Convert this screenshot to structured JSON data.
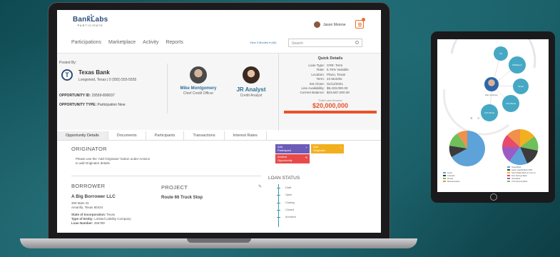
{
  "app": {
    "logo_name": "BankLabs",
    "logo_sub": "PARTICIPATE",
    "user_name": "Jason Monroe"
  },
  "nav": [
    "Participations",
    "Marketplace",
    "Activity",
    "Reports"
  ],
  "filter_text": "View 3 Months ▾  (All)",
  "search": {
    "placeholder": "Search"
  },
  "header": {
    "posted_by": "Posted By:",
    "bank": "Texas Bank",
    "bank_address": "Longwood, Texas | 0 (555) 555-5555",
    "opp_id_label": "OPPORTUNITY ID:",
    "opp_id": "15559-800037",
    "opp_type_label": "OPPORTUNITY TYPE:",
    "opp_type": "Participation New"
  },
  "people": [
    {
      "name": "Mike Montgomery",
      "title": "Chief Credit Officer"
    },
    {
      "name": "JR Analyst",
      "title": "Credit Analyst"
    }
  ],
  "quick_details": {
    "title": "Quick Details",
    "rows": [
      {
        "k": "Loan Type:",
        "v": "CRE: Term"
      },
      {
        "k": "Rate:",
        "v": "5.75% Variable"
      },
      {
        "k": "Location:",
        "v": "Plano, Texas"
      },
      {
        "k": "Term:",
        "v": "24 Months"
      },
      {
        "k": "Est Close:",
        "v": "01/12/2021"
      },
      {
        "k": "Line Availability:",
        "v": "$9,433,000.00"
      },
      {
        "k": "Current Balance:",
        "v": "$19,567,000.00"
      }
    ],
    "total_label": "Total Loan Amount",
    "total": "$20,000,000"
  },
  "tabs": [
    "Opportunity Details",
    "Documents",
    "Participants",
    "Transactions",
    "Interest Rates"
  ],
  "originator": {
    "title": "ORIGINATOR",
    "note_l1": "Please use the 'Add Originator' button under Actions",
    "note_l2": "to add Originator details."
  },
  "actions": [
    {
      "label_l1": "Add",
      "label_l2": "Participant",
      "color": "#6d5bb8"
    },
    {
      "label_l1": "Add",
      "label_l2": "Originator",
      "color": "#f2b01e"
    },
    {
      "label_l1": "Archive",
      "label_l2": "Opportunity",
      "color": "#e84a4a"
    }
  ],
  "borrower": {
    "title": "BORROWER",
    "name": "A Big Borrower LLC",
    "addr1": "300 Main St.",
    "addr2": "Amarillo, Texas 80434",
    "state_label": "State of Incorporation:",
    "state": "Texas",
    "entity_label": "Type of Entity:",
    "entity": "Limited Liability Company",
    "loan_label": "Loan Number:",
    "loan": "456789"
  },
  "project": {
    "title": "PROJECT",
    "name": "Route 66 Truck Stop"
  },
  "loan_status": {
    "title": "LOAN STATUS",
    "items": [
      "Draft",
      "Open",
      "Closing",
      "Closed",
      "Archived"
    ]
  },
  "tablet": {
    "center_name": "Alex Johnson",
    "bubbles": [
      "Lift",
      "Wildflower",
      "Texas",
      "CCH Bank",
      "CCH Bank"
    ],
    "legend_left": [
      "Texas",
      "Colorado",
      "Florida",
      "Massachusetts"
    ],
    "legend_right": [
      "Texas Bank",
      "Austin Capital Bank SSB",
      "North Dallas Bank & Trust Co",
      "First Savings Bank",
      "Vista Bank",
      "CCH Security Bank"
    ]
  },
  "colors": {
    "accent": "#e8532a",
    "brand": "#2d4d7a",
    "link": "#2d6f9a",
    "teal": "#46a8c4"
  }
}
